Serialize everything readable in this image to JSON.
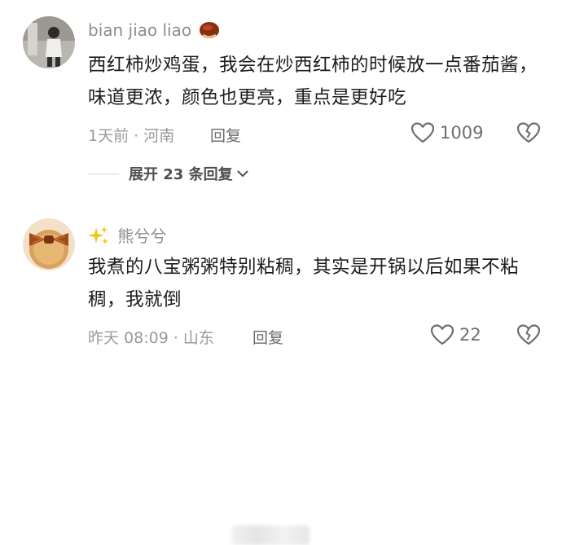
{
  "comments": [
    {
      "username": "bian jiao liao",
      "username_emoji": "chestnut-emoji",
      "avatar": "person-photo-avatar",
      "text": "西红柿炒鸡蛋，我会在炒西红柿的时候放一点番茄酱，味道更浓，颜色也更亮，重点是更好吃",
      "time_location": "1天前 · 河南",
      "reply_label": "回复",
      "likes": "1009",
      "expand_label": "展开 23 条回复"
    },
    {
      "username": "熊兮兮",
      "username_prefix_emoji": "sparkles-emoji",
      "avatar": "bow-cookie-avatar",
      "text": "我煮的八宝粥粥特别粘稠，其实是开锅以后如果不粘稠，我就倒",
      "time_location": "昨天 08:09 · 山东",
      "reply_label": "回复",
      "likes": "22"
    }
  ],
  "colors": {
    "meta_text": "#9a9a9a",
    "username": "#8d8d8d",
    "body_text": "#1c1c1c",
    "sparkles": "#f5c518"
  }
}
